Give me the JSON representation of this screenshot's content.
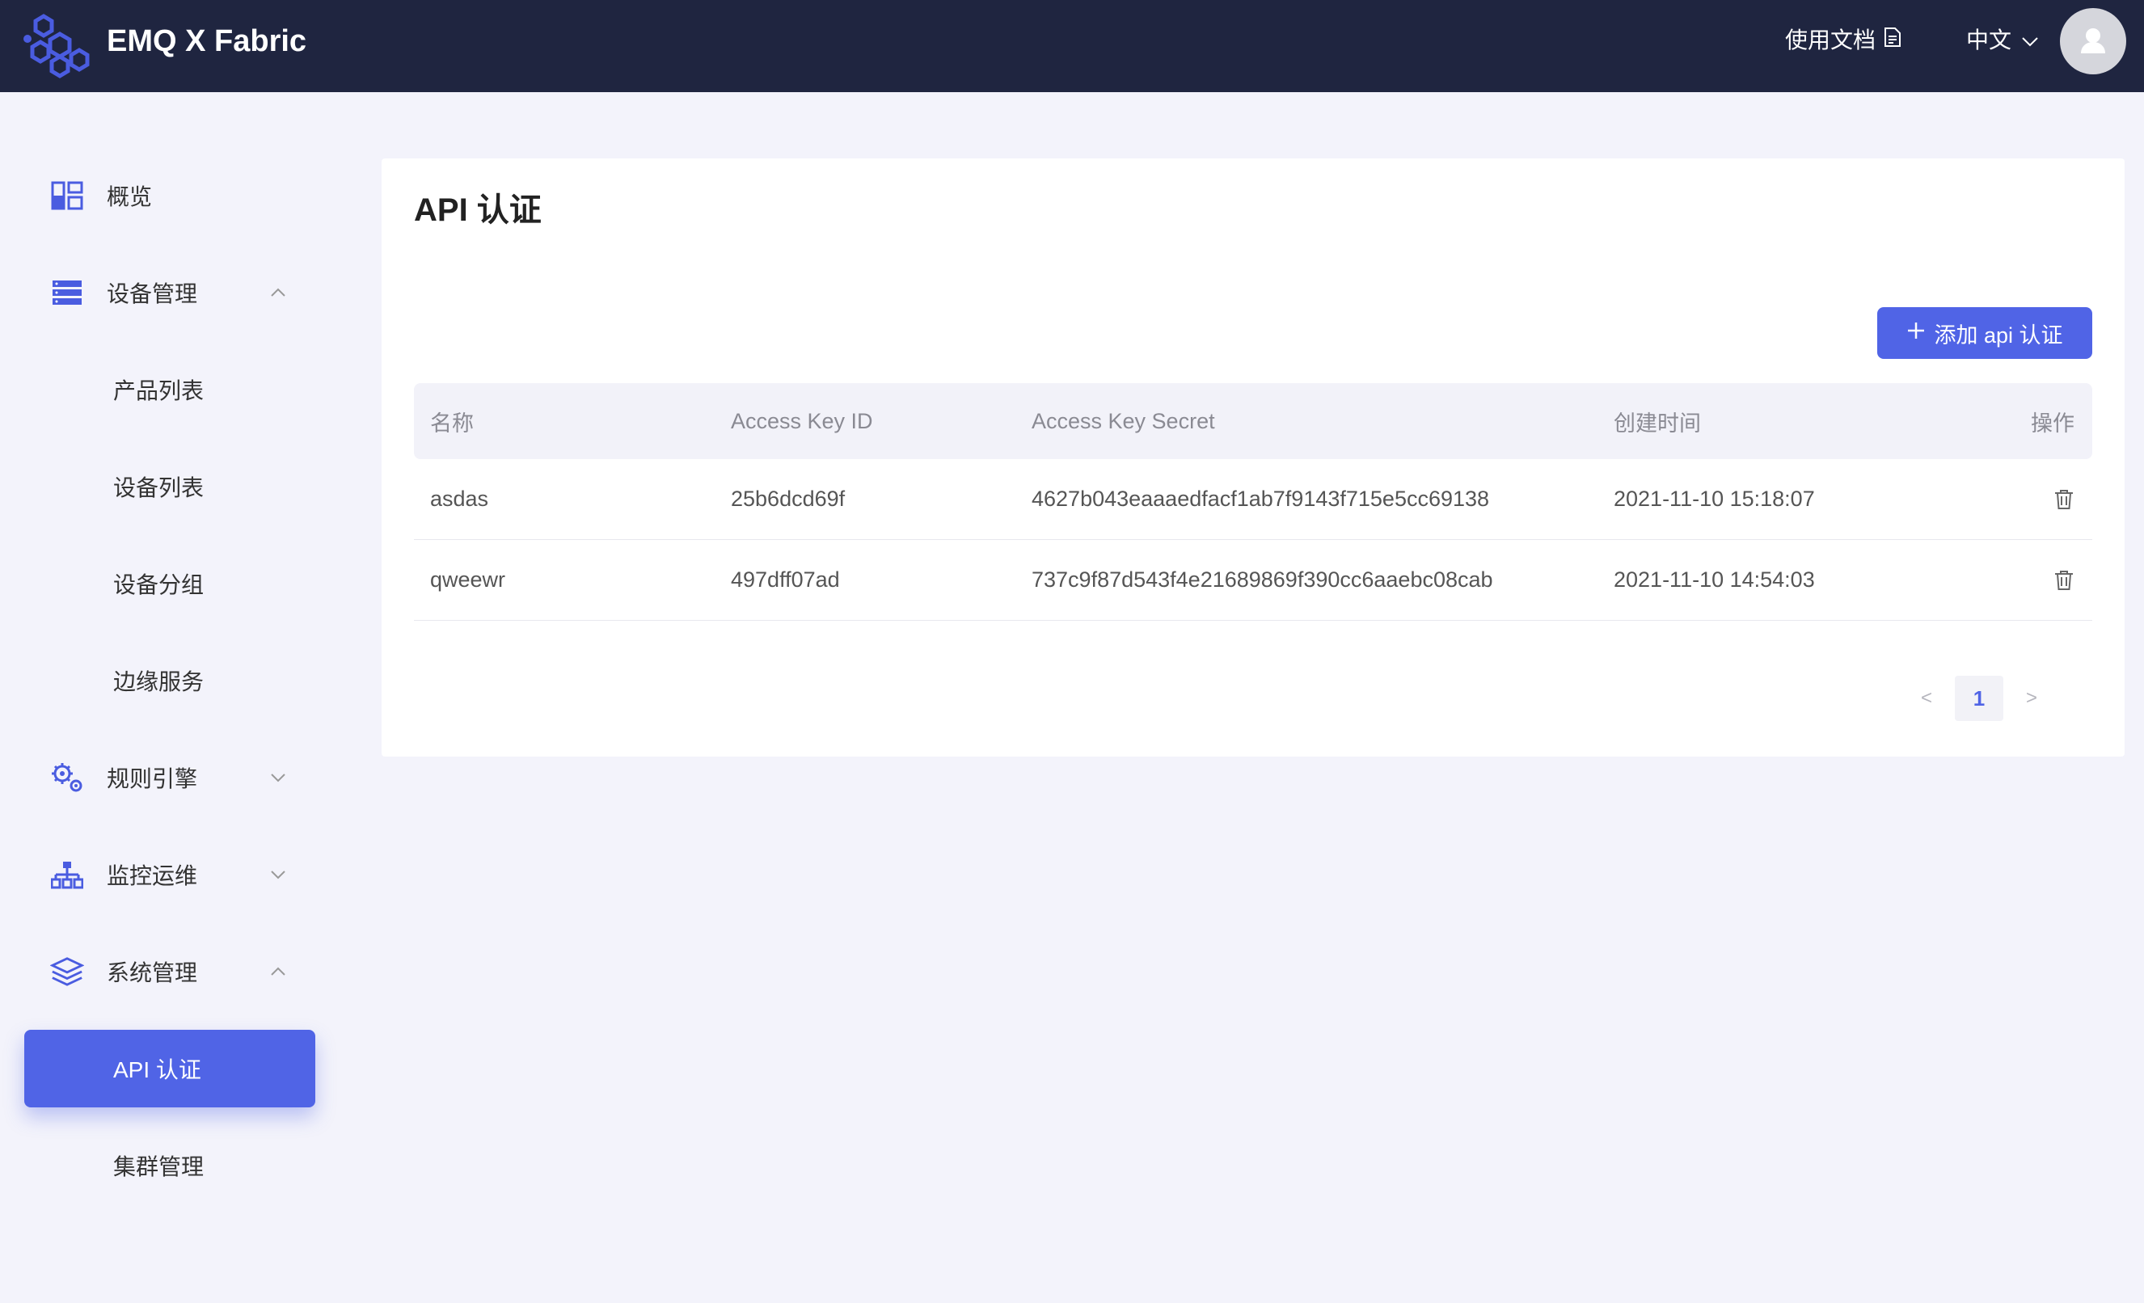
{
  "header": {
    "app_title": "EMQ X Fabric",
    "docs_label": "使用文档",
    "lang_label": "中文",
    "bg_color": "#1f2540"
  },
  "sidebar": {
    "items": [
      {
        "label": "概览",
        "icon": "dashboard-icon"
      },
      {
        "label": "设备管理",
        "icon": "server-icon",
        "expanded": true
      },
      {
        "label": "产品列表"
      },
      {
        "label": "设备列表"
      },
      {
        "label": "设备分组"
      },
      {
        "label": "边缘服务"
      },
      {
        "label": "规则引擎",
        "icon": "gears-icon",
        "expanded": false
      },
      {
        "label": "监控运维",
        "icon": "network-icon",
        "expanded": false
      },
      {
        "label": "系统管理",
        "icon": "layers-icon",
        "expanded": true
      },
      {
        "label": "API 认证",
        "active": true
      },
      {
        "label": "集群管理"
      }
    ]
  },
  "main": {
    "title": "API 认证",
    "add_button": "添加 api 认证",
    "table": {
      "headers": [
        "名称",
        "Access Key ID",
        "Access Key Secret",
        "创建时间",
        "操作"
      ],
      "rows": [
        {
          "name": "asdas",
          "key_id": "25b6dcd69f",
          "secret": "4627b043eaaaedfacf1ab7f9143f715e5cc69138",
          "created": "2021-11-10 15:18:07"
        },
        {
          "name": "qweewr",
          "key_id": "497dff07ad",
          "secret": "737c9f87d543f4e21689869f390cc6aaebc08cab",
          "created": "2021-11-10 14:54:03"
        }
      ]
    },
    "pagination": {
      "prev": "<",
      "current": "1",
      "next": ">"
    }
  },
  "colors": {
    "accent": "#5064e6",
    "page_bg": "#f3f3fb"
  }
}
